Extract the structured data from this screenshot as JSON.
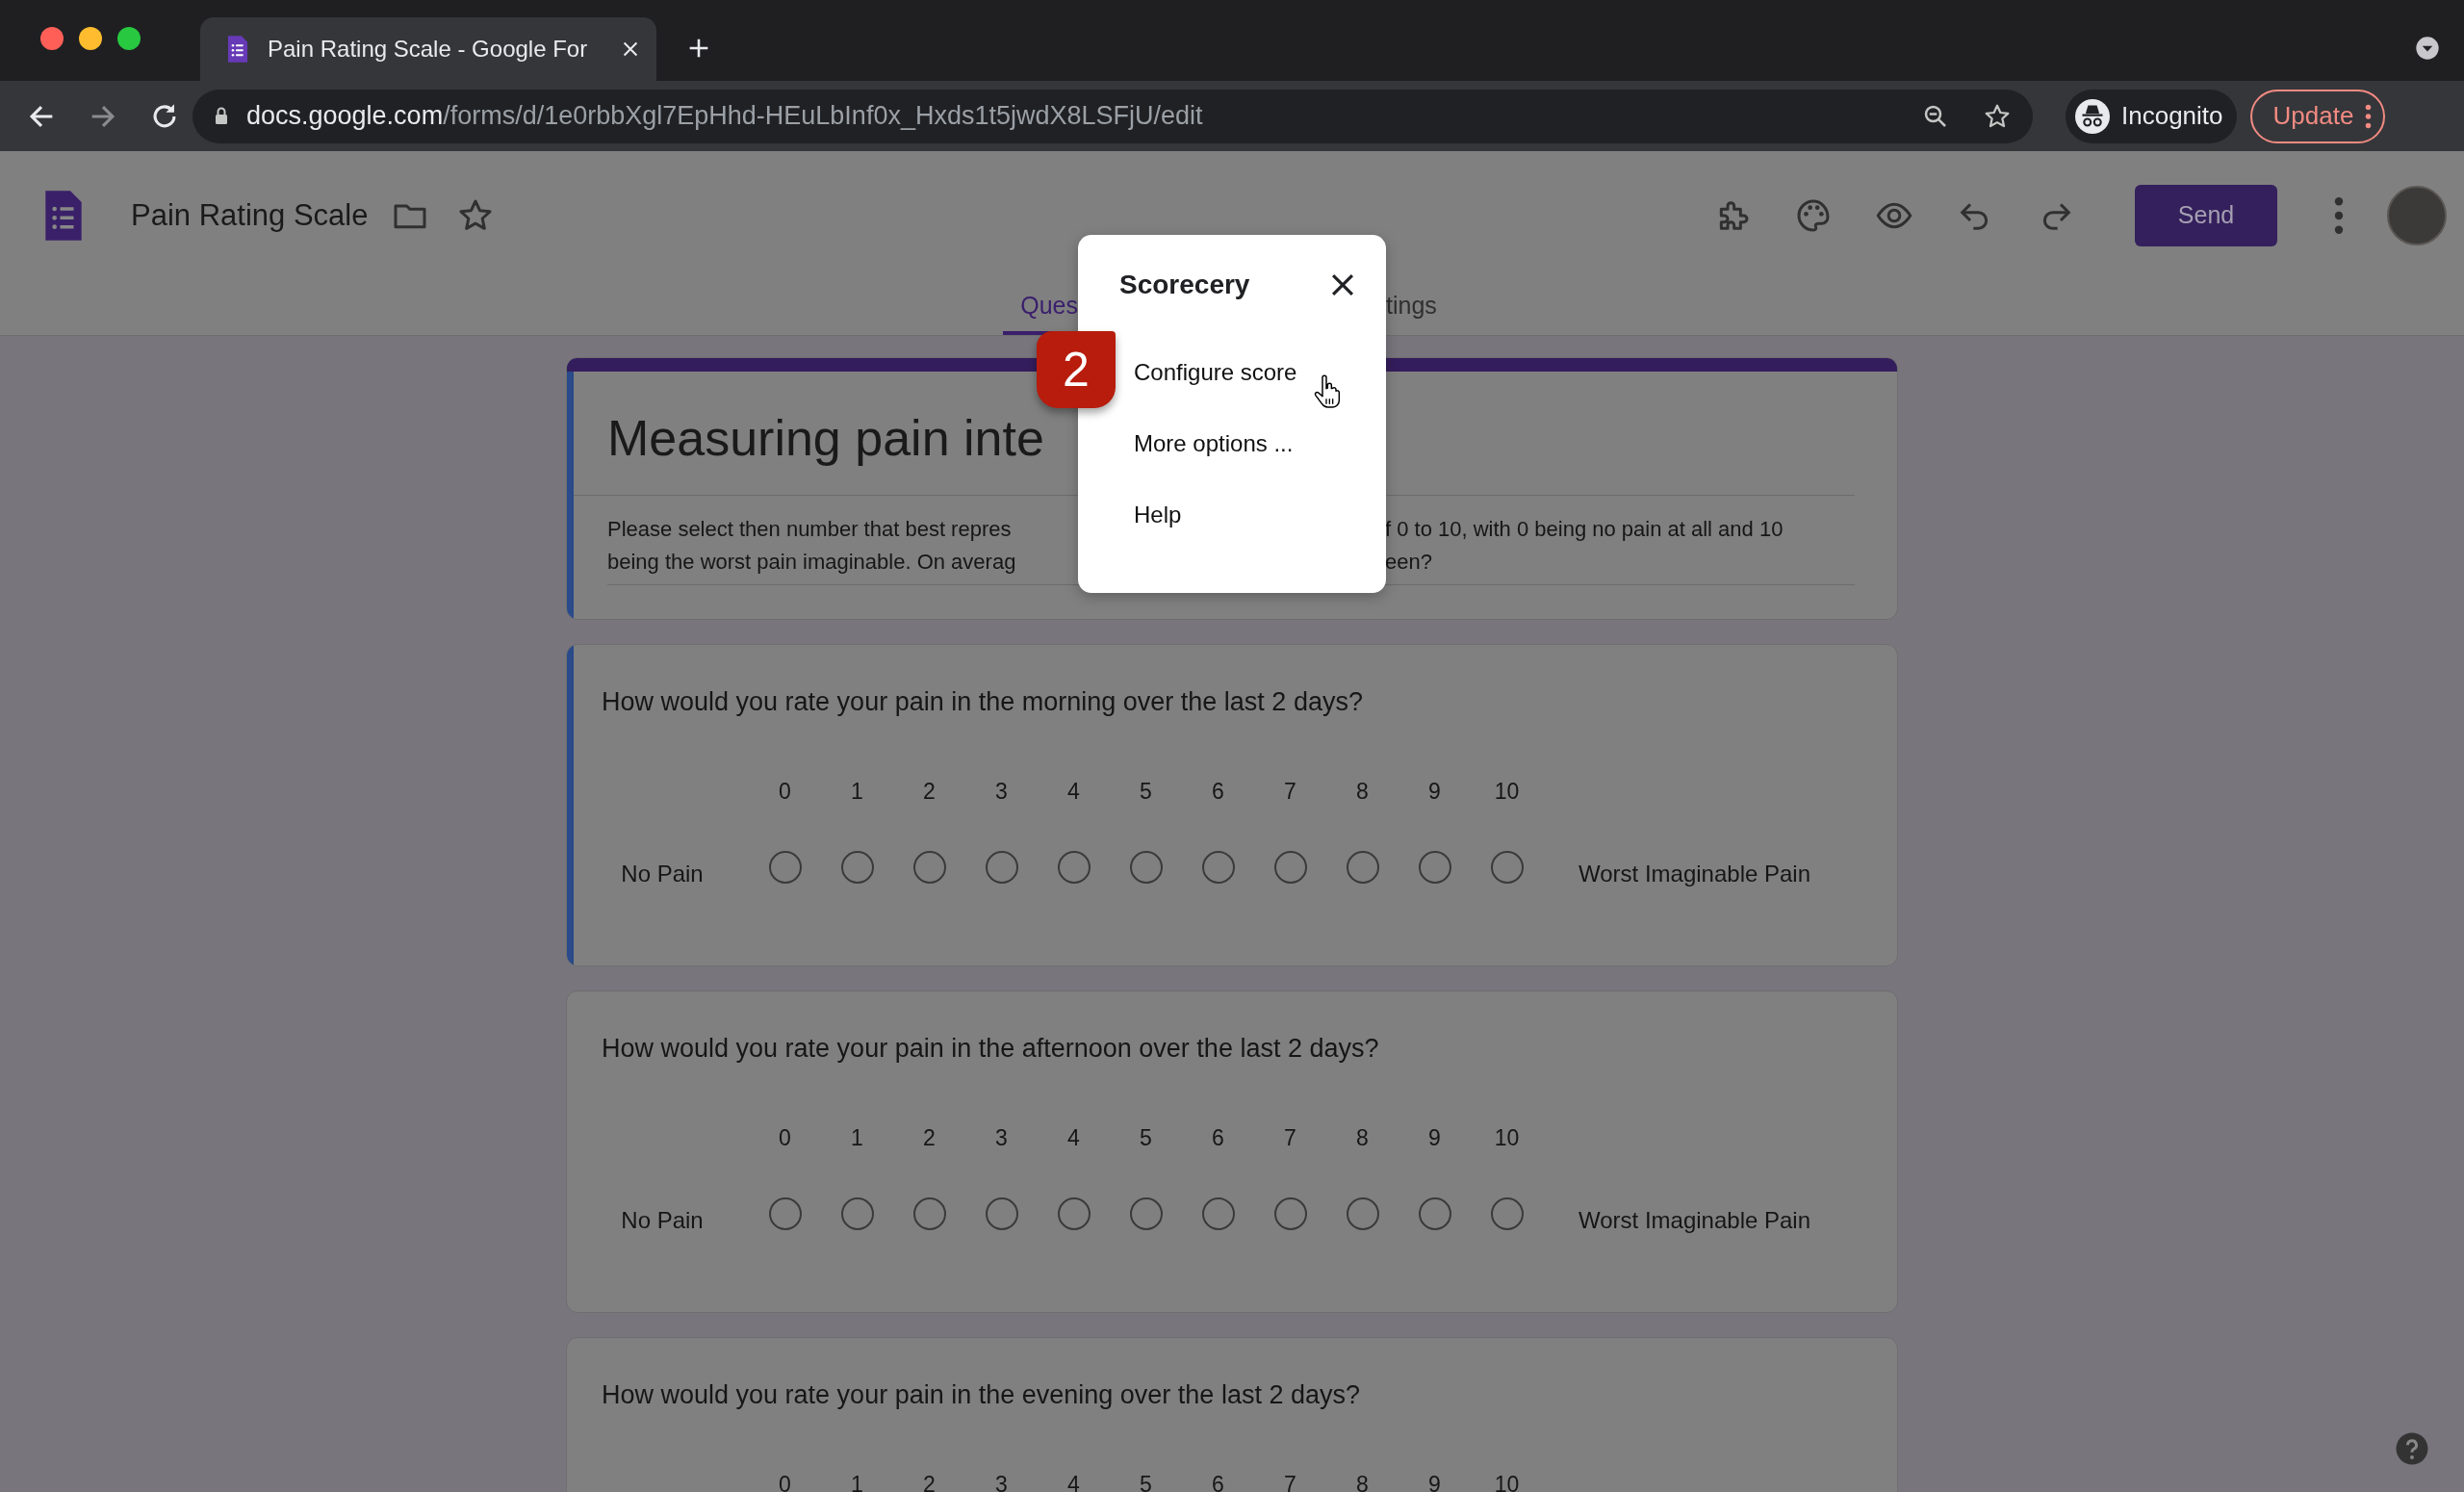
{
  "browser": {
    "tabs": [
      {
        "title": "Pain Rating Scale - Google For",
        "selected": true
      }
    ],
    "address": {
      "host": "docs.google.com",
      "path": "/forms/d/1e0rbbXgl7EpHhd-HEuLbInf0x_Hxds1t5jwdX8LSFjU/edit"
    },
    "profile": "Incognito",
    "update_button": "Update"
  },
  "header": {
    "title": "Pain Rating Scale",
    "send_button": "Send"
  },
  "tabs": [
    {
      "label": "Ques",
      "selected": true
    },
    {
      "label": "tings",
      "selected": false
    }
  ],
  "title_card": {
    "highlighted": true,
    "title": "Measuring pain inte",
    "description_lines": [
      {
        "left": "Please select then number that best repres",
        "right": "f 0 to 10, with 0 being no pain at all and 10"
      },
      {
        "left": "being the worst pain imaginable. On averag",
        "right": "een?"
      }
    ]
  },
  "questions": [
    {
      "text": "How would you rate your pain in the morning over the last 2 days?",
      "highlighted": true,
      "scale": [
        "0",
        "1",
        "2",
        "3",
        "4",
        "5",
        "6",
        "7",
        "8",
        "9",
        "10"
      ],
      "low_label": "No Pain",
      "high_label": "Worst Imaginable Pain",
      "options": [
        {
          "selected": false
        },
        {
          "selected": false
        },
        {
          "selected": false
        },
        {
          "selected": false
        },
        {
          "selected": false
        },
        {
          "selected": false
        },
        {
          "selected": false
        },
        {
          "selected": false
        },
        {
          "selected": false
        },
        {
          "selected": false
        },
        {
          "selected": false
        }
      ]
    },
    {
      "text": "How would you rate your pain in the afternoon over the last 2 days?",
      "highlighted": false,
      "scale": [
        "0",
        "1",
        "2",
        "3",
        "4",
        "5",
        "6",
        "7",
        "8",
        "9",
        "10"
      ],
      "low_label": "No Pain",
      "high_label": "Worst Imaginable Pain",
      "options": [
        {
          "selected": false
        },
        {
          "selected": false
        },
        {
          "selected": false
        },
        {
          "selected": false
        },
        {
          "selected": false
        },
        {
          "selected": false
        },
        {
          "selected": false
        },
        {
          "selected": false
        },
        {
          "selected": false
        },
        {
          "selected": false
        },
        {
          "selected": false
        }
      ]
    },
    {
      "text": "How would you rate your pain in the evening over the last 2 days?",
      "highlighted": false,
      "scale": [
        "0",
        "1",
        "2",
        "3",
        "4",
        "5",
        "6",
        "7",
        "8",
        "9",
        "10"
      ]
    }
  ],
  "popup": {
    "title": "Scorecery",
    "items": [
      "Configure score",
      "More options ...",
      "Help"
    ]
  },
  "step_badge": "2"
}
